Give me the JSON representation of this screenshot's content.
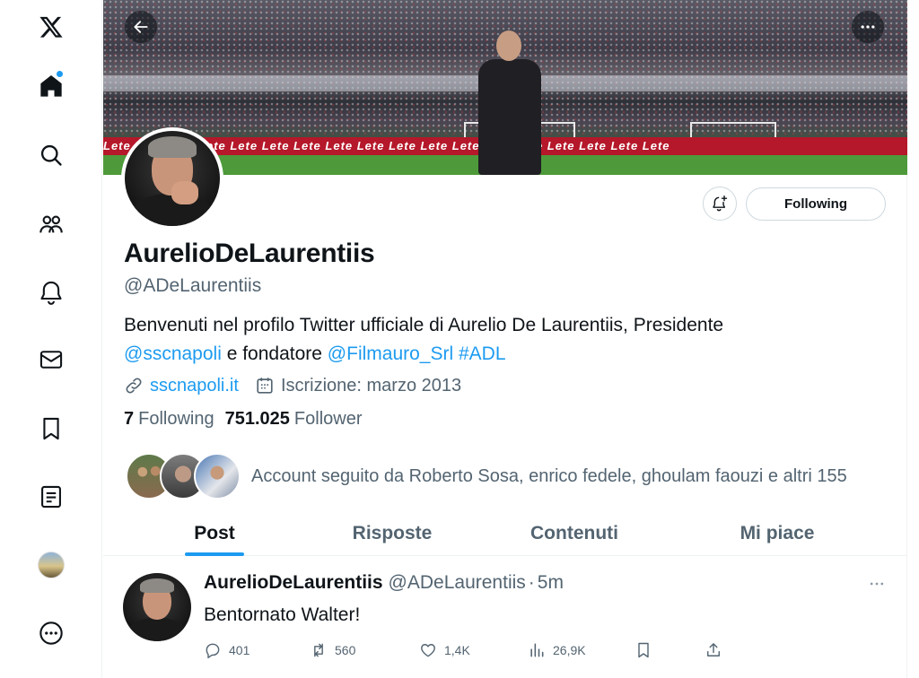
{
  "nav": {
    "items": [
      {
        "name": "x-logo-icon"
      },
      {
        "name": "home-icon",
        "has_notification_dot": true
      },
      {
        "name": "search-icon"
      },
      {
        "name": "communities-icon"
      },
      {
        "name": "notifications-icon"
      },
      {
        "name": "messages-icon"
      },
      {
        "name": "bookmarks-icon"
      },
      {
        "name": "lists-icon"
      },
      {
        "name": "profile-avatar"
      },
      {
        "name": "more-icon"
      }
    ]
  },
  "banner": {
    "ad_text": "Lete Lete Lete Lete Lete Lete Lete Lete Lete Lete Lete Lete Lete Lete Lete Lete Lete Lete",
    "back_icon": "arrow-left-icon",
    "more_icon": "more-horizontal-icon"
  },
  "profile": {
    "display_name": "AurelioDeLaurentiis",
    "handle": "@ADeLaurentiis",
    "bio_text_1": "Benvenuti nel profilo Twitter ufficiale di Aurelio De Laurentiis, Presidente",
    "bio_mention_1": "@sscnapoli",
    "bio_text_2": " e fondatore ",
    "bio_mention_2": "@Filmauro_Srl",
    "bio_hashtag": "#ADL",
    "website": "sscnapoli.it",
    "joined": "Iscrizione: marzo 2013",
    "following_count": "7",
    "following_label": "Following",
    "followers_count": "751.025",
    "followers_label": "Follower",
    "followed_by": "Account seguito da Roberto Sosa, enrico fedele, ghoulam faouzi e altri 155",
    "follow_button": "Following",
    "notify_icon": "bell-plus-icon"
  },
  "tabs": [
    {
      "label": "Post",
      "active": true
    },
    {
      "label": "Risposte",
      "active": false
    },
    {
      "label": "Contenuti",
      "active": false
    },
    {
      "label": "Mi piace",
      "active": false
    }
  ],
  "tweet": {
    "author_name": "AurelioDeLaurentiis",
    "author_handle": "@ADeLaurentiis",
    "separator": "·",
    "time": "5m",
    "text": "Bentornato Walter!",
    "replies": "401",
    "reposts": "560",
    "likes": "1,4K",
    "views": "26,9K"
  },
  "colors": {
    "accent": "#1d9bf0",
    "text_primary": "#0f1419",
    "text_secondary": "#536471",
    "border": "#eff3f4"
  }
}
